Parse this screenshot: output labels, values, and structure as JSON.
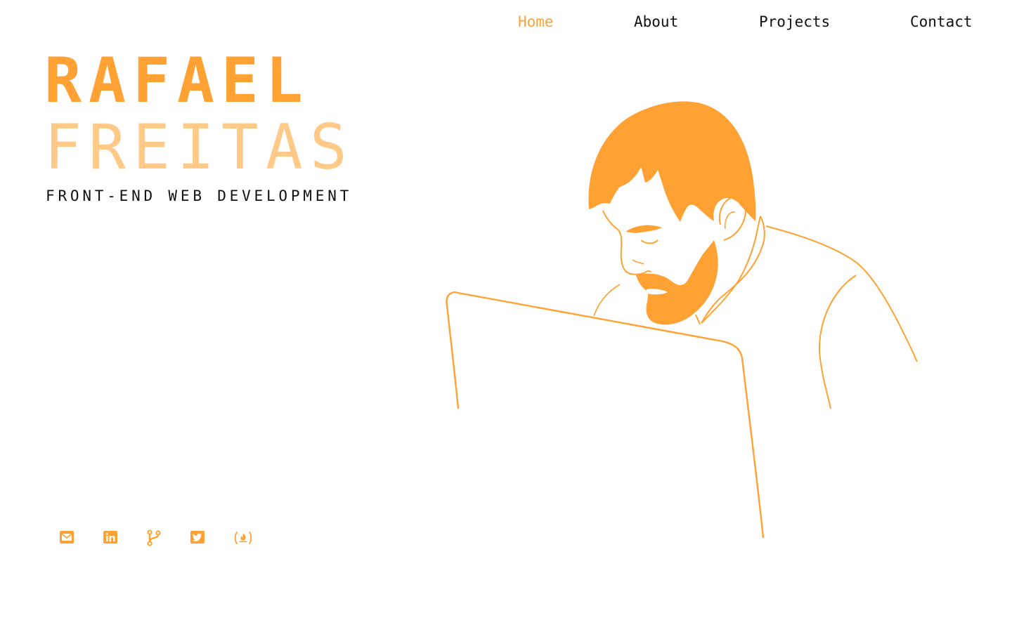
{
  "nav": {
    "items": [
      {
        "label": "Home",
        "active": true
      },
      {
        "label": "About",
        "active": false
      },
      {
        "label": "Projects",
        "active": false
      },
      {
        "label": "Contact",
        "active": false
      }
    ]
  },
  "hero": {
    "first_name": "RAFAEL",
    "last_name": "FREITAS",
    "tagline": "FRONT-END WEB DEVELOPMENT"
  },
  "socials": [
    {
      "icon": "envelope-icon"
    },
    {
      "icon": "linkedin-icon"
    },
    {
      "icon": "code-branch-icon"
    },
    {
      "icon": "twitter-icon"
    },
    {
      "icon": "freecodecamp-icon"
    }
  ],
  "illustration": {
    "subject": "developer-at-laptop"
  },
  "colors": {
    "accent": "#ffa233",
    "accent_light": "#ffca87",
    "text": "#111111",
    "background": "#ffffff"
  }
}
